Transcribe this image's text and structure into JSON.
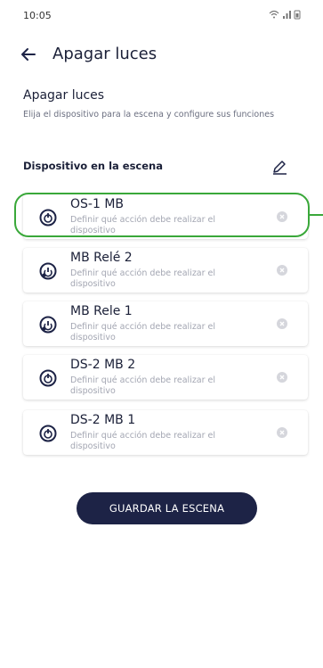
{
  "status_bar": {
    "time": "10:05"
  },
  "header": {
    "title": "Apagar luces"
  },
  "section": {
    "title": "Apagar luces",
    "description": "Elija el dispositivo para la escena y configure sus funciones"
  },
  "devices_header": "Dispositivo en la escena",
  "devices": [
    {
      "name": "OS-1 MB",
      "description": "Definir qué acción debe realizar el dispositivo",
      "icon": "power-icon",
      "highlighted": true
    },
    {
      "name": "MB Relé 2",
      "description": "Definir qué acción debe realizar el dispositivo",
      "icon": "relay-power-icon",
      "highlighted": false
    },
    {
      "name": "MB Rele 1",
      "description": "Definir qué acción debe realizar el dispositivo",
      "icon": "relay-power-icon",
      "highlighted": false
    },
    {
      "name": "DS-2 MB 2",
      "description": "Definir qué acción debe realizar el dispositivo",
      "icon": "power-icon",
      "highlighted": false
    },
    {
      "name": "DS-2 MB 1",
      "description": "Definir qué acción debe realizar el dispositivo",
      "icon": "power-icon",
      "highlighted": false
    }
  ],
  "save_button": "GUARDAR LA ESCENA",
  "colors": {
    "primary": "#1d2346",
    "highlight": "#3aa83a",
    "muted_text": "#a3a6b2",
    "clear_icon": "#d5d6dc"
  }
}
